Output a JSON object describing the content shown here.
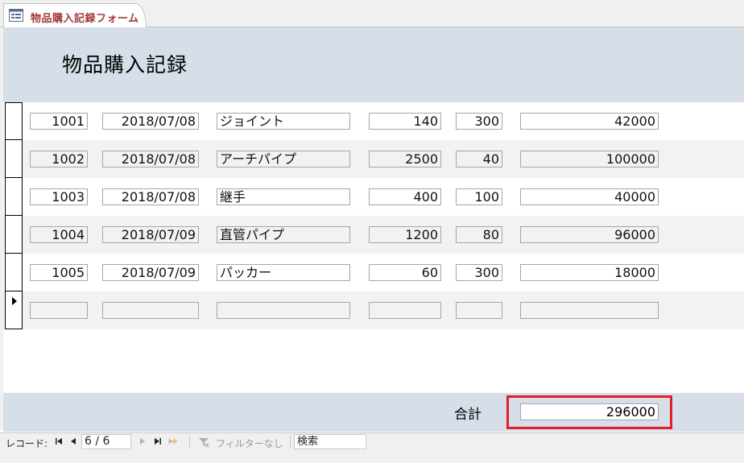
{
  "tab": {
    "label": "物品購入記録フォーム",
    "icon": "form-icon"
  },
  "form": {
    "title": "物品購入記録"
  },
  "rows": [
    {
      "id": "1001",
      "date": "2018/07/08",
      "item": "ジョイント",
      "price": "140",
      "qty": "300",
      "amount": "42000"
    },
    {
      "id": "1002",
      "date": "2018/07/08",
      "item": "アーチパイプ",
      "price": "2500",
      "qty": "40",
      "amount": "100000"
    },
    {
      "id": "1003",
      "date": "2018/07/08",
      "item": "継手",
      "price": "400",
      "qty": "100",
      "amount": "40000"
    },
    {
      "id": "1004",
      "date": "2018/07/09",
      "item": "直管パイプ",
      "price": "1200",
      "qty": "80",
      "amount": "96000"
    },
    {
      "id": "1005",
      "date": "2018/07/09",
      "item": "パッカー",
      "price": "60",
      "qty": "300",
      "amount": "18000"
    },
    {
      "id": "",
      "date": "",
      "item": "",
      "price": "",
      "qty": "",
      "amount": ""
    }
  ],
  "footer": {
    "total_label": "合計",
    "total_value": "296000"
  },
  "navigation": {
    "label": "レコード:",
    "position": "6 / 6",
    "filter_label": "フィルターなし",
    "search_label": "検索"
  },
  "colors": {
    "header_band": "#d6dfe9",
    "tab_text": "#a4373a",
    "highlight": "#e31e24"
  }
}
